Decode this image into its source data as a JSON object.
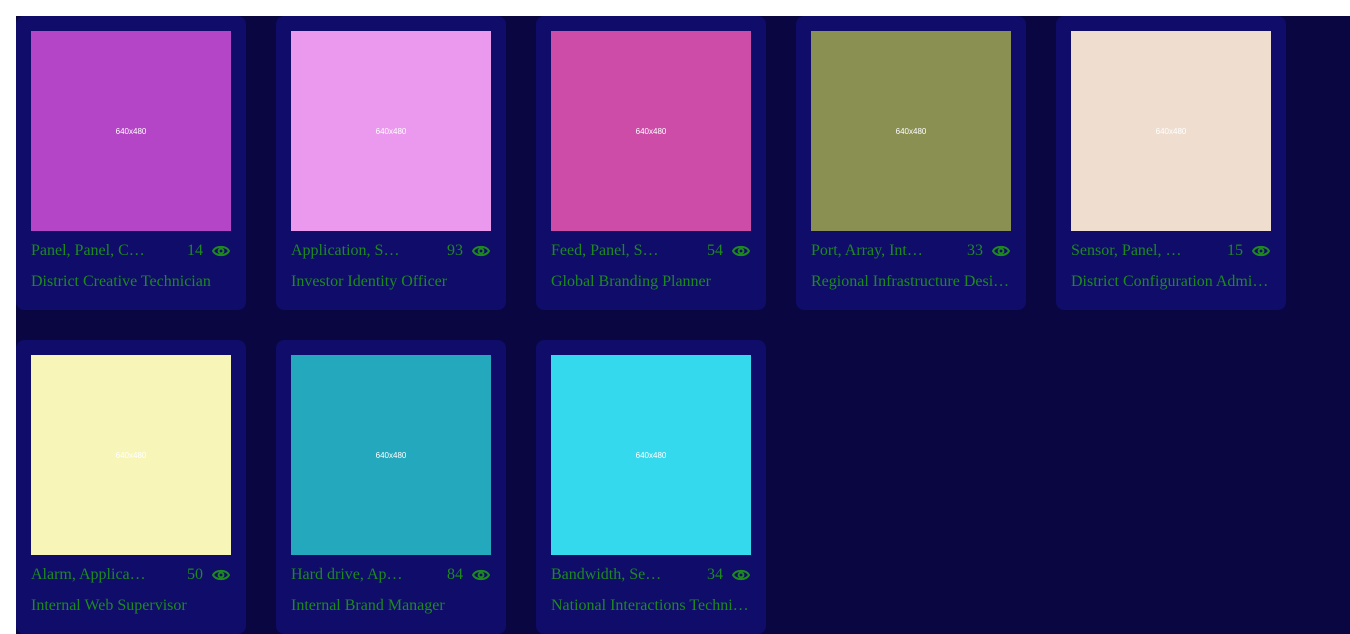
{
  "accent_color": "#1e8a1e",
  "background_color": "#0a0642",
  "card_color": "#0f0c6a",
  "cards": [
    {
      "image_label": "640x480",
      "image_color": "#b345c6",
      "tags": "Panel, Panel, C…",
      "count": "14",
      "title": "District Creative Technician"
    },
    {
      "image_label": "640x480",
      "image_color": "#ea99ee",
      "tags": "Application, S…",
      "count": "93",
      "title": "Investor Identity Officer"
    },
    {
      "image_label": "640x480",
      "image_color": "#cc4ca8",
      "tags": "Feed, Panel, S…",
      "count": "54",
      "title": "Global Branding Planner"
    },
    {
      "image_label": "640x480",
      "image_color": "#8a8f52",
      "tags": "Port, Array, Int…",
      "count": "33",
      "title": "Regional Infrastructure Desi…"
    },
    {
      "image_label": "640x480",
      "image_color": "#efdecf",
      "tags": "Sensor, Panel, …",
      "count": "15",
      "title": "District Configuration Admi…"
    },
    {
      "image_label": "640x480",
      "image_color": "#f7f6b8",
      "tags": "Alarm, Applica…",
      "count": "50",
      "title": "Internal Web Supervisor"
    },
    {
      "image_label": "640x480",
      "image_color": "#23a8bd",
      "tags": "Hard drive, Ap…",
      "count": "84",
      "title": "Internal Brand Manager"
    },
    {
      "image_label": "640x480",
      "image_color": "#35d9ed",
      "tags": "Bandwidth, Se…",
      "count": "34",
      "title": "National Interactions Techni…"
    }
  ]
}
